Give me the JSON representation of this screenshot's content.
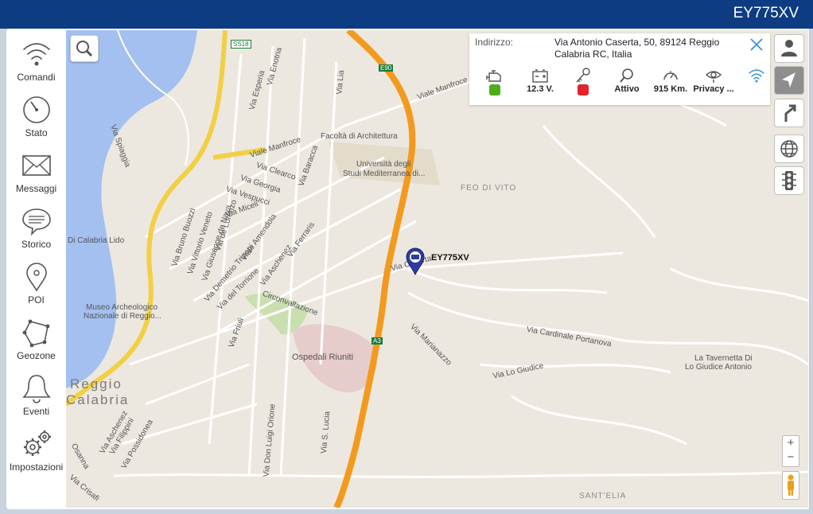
{
  "header": {
    "title": "EY775XV"
  },
  "sidebar": {
    "items": [
      {
        "label": "Comandi",
        "icon": "wifi-icon"
      },
      {
        "label": "Stato",
        "icon": "gauge-icon"
      },
      {
        "label": "Messaggi",
        "icon": "envelope-icon"
      },
      {
        "label": "Storico",
        "icon": "chat-bubble-icon"
      },
      {
        "label": "POI",
        "icon": "map-pin-icon"
      },
      {
        "label": "Geozone",
        "icon": "polygon-icon"
      },
      {
        "label": "Eventi",
        "icon": "bell-icon"
      },
      {
        "label": "Impostazioni",
        "icon": "gears-icon"
      }
    ]
  },
  "info": {
    "address_label": "Indirizzo:",
    "address_value": "Via Antonio Caserta, 50, 89124 Reggio Calabria RC, Italia",
    "stats": [
      {
        "icon": "engine-icon",
        "text": "",
        "status_color": "#4caf1a"
      },
      {
        "icon": "battery-icon",
        "text": "12.3 V."
      },
      {
        "icon": "key-icon",
        "text": "",
        "status_color": "#e0252b"
      },
      {
        "icon": "search-icon",
        "text": "Attivo"
      },
      {
        "icon": "speedometer-icon",
        "text": "915 Km."
      },
      {
        "icon": "privacy-eye-icon",
        "text": "Privacy ..."
      },
      {
        "icon": "signal-icon",
        "text": ""
      }
    ]
  },
  "map": {
    "marker_label": "EY775XV",
    "labels": {
      "viale_manfroce_top": "Viale Manfroce",
      "viale_manfroce_mid": "Viale Manfroce",
      "facolta": "Facoltà di Architettura",
      "universita_1": "Università degli",
      "universita_2": "Studi Mediterranea di...",
      "feo_di_vito": "FEO DI VITO",
      "via_clearco": "Via Clearco",
      "via_georgia": "Via Georgia",
      "via_vespucci": "Via Vespucci",
      "via_miceli": "Via Miceli",
      "via_baracca": "Via Baracca",
      "via_amendola": "Viale Amendola",
      "via_ferraris": "Via Ferraris",
      "via_aschenez": "Via Aschenez",
      "via_tripepi": "Via Demetrio Tripepi",
      "via_torrione": "Via del Torrione",
      "circonvallazione": "Circonvallazione",
      "via_friuli": "Via Friuli",
      "ospedali": "Ospedali Riuniti",
      "museo_1": "Museo Archeologico",
      "museo_2": "Nazionale di Reggio...",
      "reggio": "Reggio",
      "calabria": "Calabria",
      "lido": "Di Calabria Lido",
      "via_spiaggia": "Via Spiaggia",
      "via_buozzi": "Via Bruno Buozzi",
      "via_veneto": "Via Vittorio Veneto",
      "via_navа": "Via Giuseppe de Nava",
      "via_lorenzo": "Via de Lorenzo",
      "via_esperia": "Via Esperia",
      "via_enotria": "Via Enotria",
      "via_lia": "Via Lia",
      "via_caserta": "Via Caserta",
      "via_marianazzo": "Via Marianazzo",
      "via_portanova": "Via Cardinale Portanova",
      "via_giudice": "Via Lo Giudice",
      "tavernetta_1": "La Tavernetta Di",
      "tavernetta_2": "Lo Giudice Antonio",
      "via_s_lucia": "Via S. Lucia",
      "via_orione": "Via Don Luigi Orione",
      "via_filippini": "Via Filippini",
      "via_possidonea": "Via Possidonea",
      "via_aschenez2": "Via Aschenez",
      "via_osanna": "Osanna",
      "via_crisafi": "Via Crisafi",
      "santelia": "SANT'ELIA",
      "ss18": "SS18",
      "e90": "E90",
      "a3": "A3"
    },
    "zoom_in": "+",
    "zoom_out": "−"
  },
  "right_toolbar": [
    {
      "icon": "person-icon",
      "active": false
    },
    {
      "icon": "navigate-arrow-icon",
      "active": true
    },
    {
      "icon": "route-fork-icon",
      "active": false
    },
    {
      "icon": "globe-icon",
      "active": false
    },
    {
      "icon": "traffic-light-icon",
      "active": false
    }
  ]
}
